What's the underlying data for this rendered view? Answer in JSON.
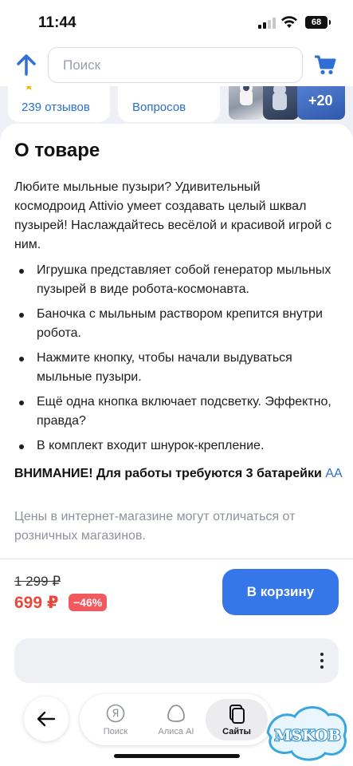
{
  "status_bar": {
    "time": "11:44",
    "battery": "68"
  },
  "search": {
    "placeholder": "Поиск"
  },
  "stats": {
    "reviews": "239 отзывов",
    "questions": "Вопросов",
    "more_photos": "+20"
  },
  "product": {
    "section_title": "О товаре",
    "intro": "Любите мыльные пузыри? Удивительный космодроид Attivio умеет создавать целый шквал пузырей! Наслаждайтесь весёлой и красивой игрой с ним.",
    "bullets": [
      "Игрушка представляет собой генератор мыльных пузырей в виде робота-космонавта.",
      "Баночка с мыльным раствором крепится внутри робота.",
      "Нажмите кнопку, чтобы начали выдуваться мыльные пузыри.",
      "Ещё одна кнопка включает подсветку. Эффектно, правда?",
      "В комплект входит шнурок-крепление."
    ],
    "warning": "ВНИМАНИЕ! Для работы требуются 3 батарейки",
    "warning_link": "АА",
    "note": "Цены в интернет-магазине могут отличаться от розничных магазинов."
  },
  "price": {
    "old": "1 299 ₽",
    "new": "699 ₽",
    "discount": "−46%",
    "button": "В корзину"
  },
  "browser": {
    "tabs": [
      {
        "label": "Поиск",
        "icon": "yandex-logo-icon"
      },
      {
        "label": "Алиса AI",
        "icon": "alice-icon"
      },
      {
        "label": "Сайты",
        "icon": "tabs-icon"
      }
    ]
  },
  "watermark": "MSKOB",
  "colors": {
    "accent": "#3576e8",
    "link": "#2a6fc9",
    "sale": "#e8473b"
  }
}
